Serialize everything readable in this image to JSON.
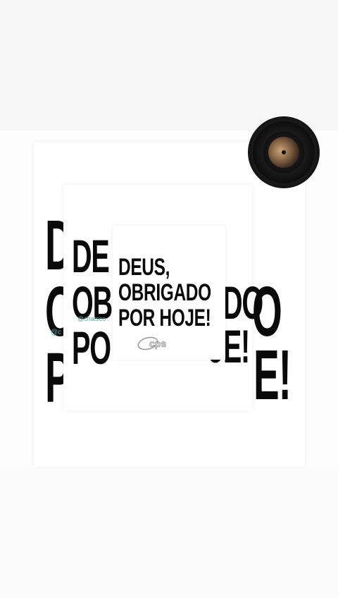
{
  "artwork": {
    "outer": {
      "letters": [
        "D",
        "O",
        "P",
        "O",
        "E!"
      ],
      "handle": "@c"
    },
    "middle": {
      "letters": [
        "DE",
        "OB",
        "PO",
        "DO",
        "JE!"
      ],
      "handle": "@chatsco"
    },
    "inner": {
      "line1": "DEUS,",
      "line2": "OBRIGADO",
      "line3": "POR HOJE!",
      "logo": "cps"
    }
  },
  "player": {
    "icon": "vinyl-record-icon"
  },
  "colors": {
    "text": "#0a0a0a",
    "handle": "#5aa9a4",
    "background": "#fdfdfd"
  }
}
